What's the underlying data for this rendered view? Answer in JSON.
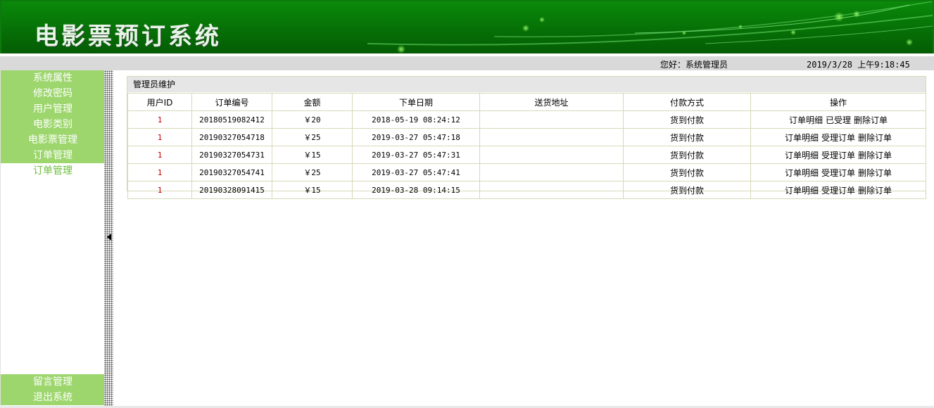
{
  "header": {
    "title": "电影票预订系统",
    "greeting": "您好：系统管理员",
    "datetime": "2019/3/28 上午9:18:45"
  },
  "colors": {
    "banner_green": "#067006",
    "menu_green": "#9cd66c",
    "menu_text_plain": "#6cbf3c",
    "user_id_red": "#c00000",
    "table_border": "#d8d8b8"
  },
  "sidebar": {
    "items": [
      {
        "label": "系统属性"
      },
      {
        "label": "修改密码"
      },
      {
        "label": "用户管理"
      },
      {
        "label": "电影类别"
      },
      {
        "label": "电影票管理"
      },
      {
        "label": "订单管理"
      },
      {
        "label": "订单管理"
      }
    ],
    "bottom_items": [
      {
        "label": "留言管理"
      },
      {
        "label": "退出系统"
      }
    ]
  },
  "panel": {
    "title": "管理员维护"
  },
  "table": {
    "columns": [
      "用户ID",
      "订单编号",
      "金额",
      "下单日期",
      "送货地址",
      "付款方式",
      "操作"
    ],
    "rows": [
      {
        "user_id": "1",
        "order_no": "20180519082412",
        "amount": "￥20",
        "date": "2018-05-19 08:24:12",
        "address": "",
        "payment": "货到付款",
        "ops": [
          "订单明细",
          "已受理",
          "删除订单"
        ]
      },
      {
        "user_id": "1",
        "order_no": "20190327054718",
        "amount": "￥25",
        "date": "2019-03-27 05:47:18",
        "address": "",
        "payment": "货到付款",
        "ops": [
          "订单明细",
          "受理订单",
          "删除订单"
        ]
      },
      {
        "user_id": "1",
        "order_no": "20190327054731",
        "amount": "￥15",
        "date": "2019-03-27 05:47:31",
        "address": "",
        "payment": "货到付款",
        "ops": [
          "订单明细",
          "受理订单",
          "删除订单"
        ]
      },
      {
        "user_id": "1",
        "order_no": "20190327054741",
        "amount": "￥25",
        "date": "2019-03-27 05:47:41",
        "address": "",
        "payment": "货到付款",
        "ops": [
          "订单明细",
          "受理订单",
          "删除订单"
        ]
      },
      {
        "user_id": "1",
        "order_no": "20190328091415",
        "amount": "￥15",
        "date": "2019-03-28 09:14:15",
        "address": "",
        "payment": "货到付款",
        "ops": [
          "订单明细",
          "受理订单",
          "删除订单"
        ]
      }
    ]
  },
  "icons": {
    "splitter": "collapse-left-arrow-icon"
  }
}
